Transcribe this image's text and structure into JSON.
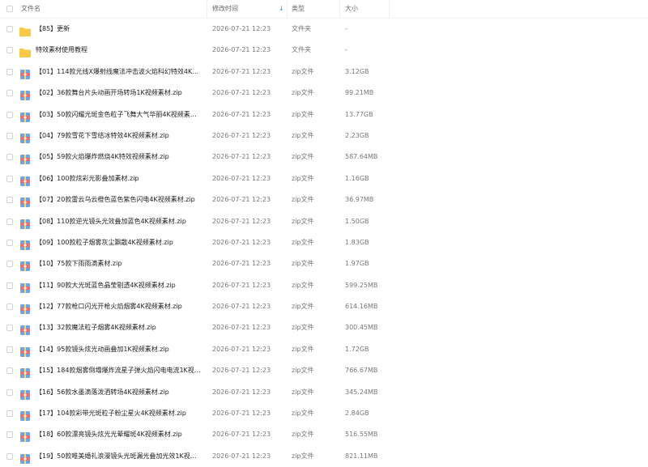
{
  "header": {
    "name": "文件名",
    "time": "修改时间",
    "type": "类型",
    "size": "大小"
  },
  "rows": [
    {
      "name": "【85】更新",
      "time": "2026-07-21 12:23",
      "type": "文件夹",
      "size": "-",
      "icon": "folder-icon"
    },
    {
      "name": "特效素材使用教程",
      "time": "2026-07-21 12:23",
      "type": "文件夹",
      "size": "-",
      "icon": "folder-icon"
    },
    {
      "name": "【01】114款光线X爆射线魔法冲击波火焰科幻特效4K视...",
      "time": "2026-07-21 12:23",
      "type": "zip文件",
      "size": "3.12GB",
      "icon": "zip-icon"
    },
    {
      "name": "【02】36款舞台片头动画开场转场1K视频素材.zip",
      "time": "2026-07-21 12:23",
      "type": "zip文件",
      "size": "99.21MB",
      "icon": "zip-icon"
    },
    {
      "name": "【03】50款闪耀光斑金色粒子飞舞大气华丽4K视频素材.z...",
      "time": "2026-07-21 12:23",
      "type": "zip文件",
      "size": "13.77GB",
      "icon": "zip-icon"
    },
    {
      "name": "【04】79款雪花下雪结冰特效4K视频素材.zip",
      "time": "2026-07-21 12:23",
      "type": "zip文件",
      "size": "2.23GB",
      "icon": "zip-icon"
    },
    {
      "name": "【05】59款火焰爆炸燃烧4K特效视频素材.zip",
      "time": "2026-07-21 12:23",
      "type": "zip文件",
      "size": "587.64MB",
      "icon": "zip-icon"
    },
    {
      "name": "【06】100款炫彩光影叠加素材.zip",
      "time": "2026-07-21 12:23",
      "type": "zip文件",
      "size": "1.16GB",
      "icon": "zip-icon"
    },
    {
      "name": "【07】20款雷云乌云橙色蓝色紫色闪电4K视频素材.zip",
      "time": "2026-07-21 12:23",
      "type": "zip文件",
      "size": "36.97MB",
      "icon": "zip-icon"
    },
    {
      "name": "【08】110款逆光镜头光效叠加蓝色4K视频素材.zip",
      "time": "2026-07-21 12:23",
      "type": "zip文件",
      "size": "1.50GB",
      "icon": "zip-icon"
    },
    {
      "name": "【09】100款粒子烟雾灰尘飘散4K视频素材.zip",
      "time": "2026-07-21 12:23",
      "type": "zip文件",
      "size": "1.83GB",
      "icon": "zip-icon"
    },
    {
      "name": "【10】75款下雨雨滴素材.zip",
      "time": "2026-07-21 12:23",
      "type": "zip文件",
      "size": "1.97GB",
      "icon": "zip-icon"
    },
    {
      "name": "【11】90款大光斑蓝色晶莹剔透4K视频素材.zip",
      "time": "2026-07-21 12:23",
      "type": "zip文件",
      "size": "599.25MB",
      "icon": "zip-icon"
    },
    {
      "name": "【12】77款枪口闪光开枪火焰烟雾4K视频素材.zip",
      "time": "2026-07-21 12:23",
      "type": "zip文件",
      "size": "614.16MB",
      "icon": "zip-icon"
    },
    {
      "name": "【13】32款魔法粒子烟雾4K视频素材.zip",
      "time": "2026-07-21 12:23",
      "type": "zip文件",
      "size": "300.45MB",
      "icon": "zip-icon"
    },
    {
      "name": "【14】95款镜头炫光动画叠加1K视频素材.zip",
      "time": "2026-07-21 12:23",
      "type": "zip文件",
      "size": "1.72GB",
      "icon": "zip-icon"
    },
    {
      "name": "【15】184款烟雾倒塌爆炸流星子弹火焰闪电电流1K视频...",
      "time": "2026-07-21 12:23",
      "type": "zip文件",
      "size": "766.67MB",
      "icon": "zip-icon"
    },
    {
      "name": "【16】56款水墨滴落泼洒转场4K视频素材.zip",
      "time": "2026-07-21 12:23",
      "type": "zip文件",
      "size": "345.24MB",
      "icon": "zip-icon"
    },
    {
      "name": "【17】104款彩带光斑粒子粉尘星火4K视频素材.zip",
      "time": "2026-07-21 12:23",
      "type": "zip文件",
      "size": "2.84GB",
      "icon": "zip-icon"
    },
    {
      "name": "【18】60款漂亮镜头炫光光晕耀斑4K视频素材.zip",
      "time": "2026-07-21 12:23",
      "type": "zip文件",
      "size": "516.55MB",
      "icon": "zip-icon"
    },
    {
      "name": "【19】50款唯美婚礼浪漫镜头光斑漏光叠加光效1K视频...",
      "time": "2026-07-21 12:23",
      "type": "zip文件",
      "size": "821.11MB",
      "icon": "zip-icon"
    }
  ],
  "colors": {
    "folder": "#f8c948",
    "zip_bg": "#6fa3e8",
    "zip_band": "#f26d6d",
    "sort_accent": "#3a8ee6"
  }
}
